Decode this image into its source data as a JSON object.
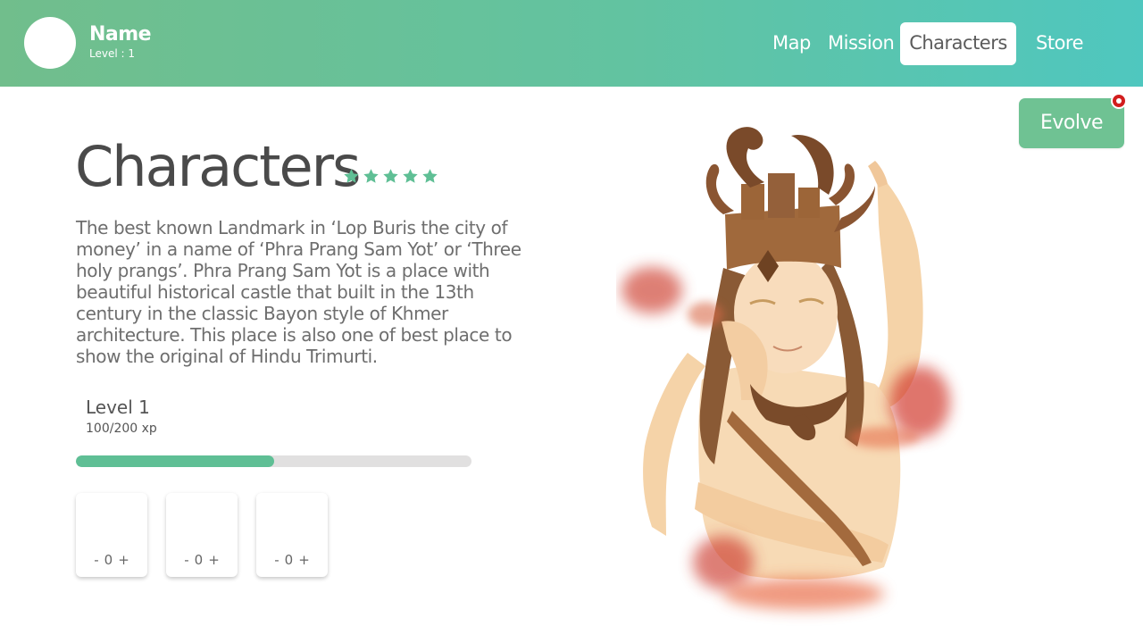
{
  "user": {
    "name": "Name",
    "level_text": "Level : 1"
  },
  "nav": {
    "items": [
      {
        "label": "Map"
      },
      {
        "label": "Mission"
      },
      {
        "label": "Characters",
        "active": true
      },
      {
        "label": "Store"
      }
    ]
  },
  "evolve": {
    "label": "Evolve",
    "has_notification": true
  },
  "character": {
    "title": "Characters",
    "stars": 5,
    "description": "The best known Landmark in ‘Lop Buris the city of money’ in a name of ‘Phra Prang Sam Yot’ or ‘Three holy prangs’. Phra Prang Sam Yot is a place with beautiful historical castle that built in the 13th century in the classic Bayon style of Khmer architecture. This place is also one of best place to show the original of Hindu Trimurti.",
    "level_label": "Level 1",
    "xp_label": "100/200 xp",
    "xp_progress": 0.5
  },
  "stat_cards": [
    {
      "minus": "-",
      "value": "0",
      "plus": "+"
    },
    {
      "minus": "-",
      "value": "0",
      "plus": "+"
    },
    {
      "minus": "-",
      "value": "0",
      "plus": "+"
    }
  ],
  "colors": {
    "header_gradient_start": "#71be8c",
    "header_gradient_end": "#4fc7bf",
    "accent_green": "#6fc293",
    "progress_fill": "#5fbf95",
    "progress_track": "#e1e0e0",
    "notification_red": "#d21e1e",
    "title_text": "#4a4a4a"
  },
  "icons": {
    "avatar": "avatar-placeholder",
    "star": "star-icon",
    "notification": "notification-dot-icon"
  }
}
